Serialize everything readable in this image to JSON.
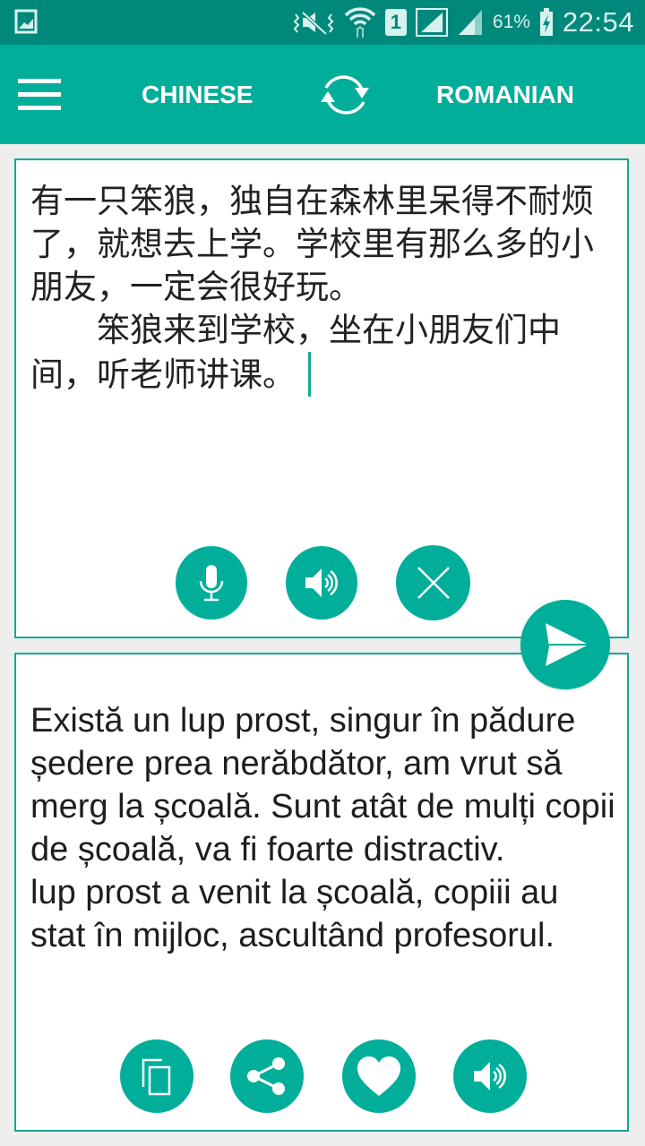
{
  "status_bar": {
    "notification_icon": "image-icon",
    "icons": [
      "vibrate-mute-icon",
      "wifi-icon",
      "sim-1-icon",
      "signal-sim1-icon",
      "signal-sim2-icon"
    ],
    "sim_label": "1",
    "battery_percent": "61%",
    "battery_icon": "battery-charging-icon",
    "time": "22:54"
  },
  "toolbar": {
    "menu_icon": "hamburger-menu-icon",
    "source_language": "CHINESE",
    "swap_icon": "swap-languages-icon",
    "target_language": "ROMANIAN"
  },
  "source_panel": {
    "text": "有一只笨狼，独自在森林里呆得不耐烦了，就想去上学。学校里有那么多的小朋友，一定会很好玩。\n　　笨狼来到学校，坐在小朋友们中间，听老师讲课。",
    "buttons": [
      {
        "name": "microphone",
        "icon": "microphone-icon"
      },
      {
        "name": "speak-source",
        "icon": "speaker-icon"
      },
      {
        "name": "clear",
        "icon": "close-icon"
      }
    ]
  },
  "send_button": {
    "icon": "send-icon"
  },
  "target_panel": {
    "text": "Există un lup prost, singur în pădure ședere prea nerăbdător, am vrut să merg la școală. Sunt atât de mulți copii de școală, va fi foarte distractiv.\nlup prost a venit la școală, copiii au stat în mijloc, ascultând profesorul.",
    "buttons": [
      {
        "name": "copy",
        "icon": "copy-icon"
      },
      {
        "name": "share",
        "icon": "share-icon"
      },
      {
        "name": "favorite",
        "icon": "heart-icon"
      },
      {
        "name": "speak-target",
        "icon": "speaker-icon"
      }
    ]
  },
  "colors": {
    "status_bar": "#00897b",
    "accent": "#00ae9a",
    "panel_border": "#13a897",
    "background": "#eeeeee"
  }
}
